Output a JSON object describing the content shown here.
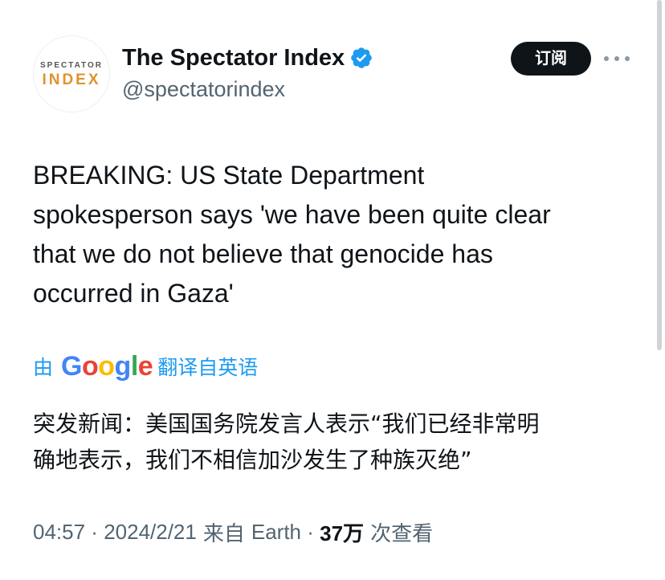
{
  "account": {
    "display_name": "The Spectator Index",
    "handle": "@spectatorindex",
    "avatar_line1": "SPECTATOR",
    "avatar_line2": "INDEX",
    "verified": true
  },
  "header": {
    "subscribe_label": "订阅",
    "more_icon": "more-horizontal-icon"
  },
  "tweet": {
    "text_lines": [
      "BREAKING: US State Department",
      "spokesperson says 'we have been quite clear",
      "that we do not believe that genocide has",
      "occurred in Gaza'"
    ]
  },
  "translation": {
    "prefix": "由",
    "brand": "Google",
    "suffix": "翻译自英语",
    "text_lines": [
      "突发新闻：美国国务院发言人表示“我们已经非常明",
      "确地表示，我们不相信加沙发生了种族灭绝”"
    ]
  },
  "meta": {
    "time": "04:57",
    "date": "2024/2/21",
    "source_prefix": "来自",
    "source": "Earth",
    "views_count": "37万",
    "views_label": "次查看"
  },
  "colors": {
    "accent": "#1d9bf0",
    "text": "#0f1419",
    "secondary": "#536471",
    "avatar_orange": "#e0932d"
  }
}
